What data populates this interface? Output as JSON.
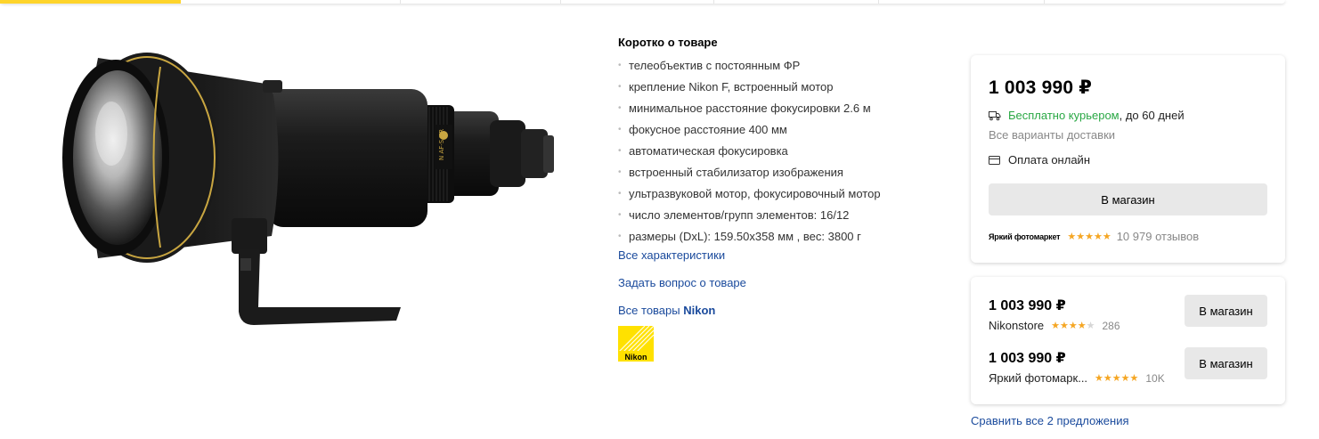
{
  "brief": {
    "title": "Коротко о товаре",
    "specs": [
      "телеобъектив с постоянным ФР",
      "крепление Nikon F, встроенный мотор",
      "минимальное расстояние фокусировки 2.6 м",
      "фокусное расстояние 400 мм",
      "автоматическая фокусировка",
      "встроенный стабилизатор изображения",
      "ультразвуковой мотор, фокусировочный мотор",
      "число элементов/групп элементов: 16/12",
      "размеры (DxL): 159.50x358 мм , вес: 3800 г"
    ],
    "all_specs_link": "Все характеристики",
    "ask_link": "Задать вопрос о товаре",
    "brand_link_prefix": "Все товары",
    "brand_name": "Nikon",
    "brand_logo_text": "Nikon"
  },
  "main_offer": {
    "price": "1 003 990 ₽",
    "delivery_free": "Бесплатно курьером",
    "delivery_term": ", до 60 дней",
    "delivery_options": "Все варианты доставки",
    "payment": "Оплата онлайн",
    "button": "В магазин",
    "shop_logo_text": "Яркий фотомаркет",
    "shop_rating": 5,
    "reviews": "10 979 отзывов"
  },
  "offers": [
    {
      "price": "1 003 990 ₽",
      "shop": "Nikonstore",
      "rating": 4,
      "count": "286",
      "button": "В магазин"
    },
    {
      "price": "1 003 990 ₽",
      "shop": "Яркий фотомарк...",
      "rating": 5,
      "count": "10K",
      "button": "В магазин"
    }
  ],
  "compare_link": "Сравнить все 2 предложения",
  "colors": {
    "accent_yellow": "#fed42b",
    "link": "#1a4a9c",
    "green": "#2aa845",
    "star": "#f5a623"
  },
  "icons": [
    "truck-icon",
    "card-icon",
    "star-icon"
  ]
}
